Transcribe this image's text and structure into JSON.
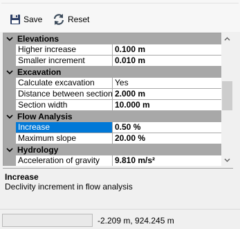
{
  "toolbar": {
    "save_label": "Save",
    "reset_label": "Reset"
  },
  "grid": {
    "categories": [
      {
        "label": "Elevations",
        "properties": [
          {
            "name": "Higher increase",
            "value": "0.100 m"
          },
          {
            "name": "Smaller increment",
            "value": "0.010 m"
          }
        ]
      },
      {
        "label": "Excavation",
        "properties": [
          {
            "name": "Calculate excavation",
            "value": "Yes"
          },
          {
            "name": "Distance between sections",
            "value": "2.000 m"
          },
          {
            "name": "Section width",
            "value": "10.000 m"
          }
        ]
      },
      {
        "label": "Flow Analysis",
        "properties": [
          {
            "name": "Increase",
            "value": "0.50 %"
          },
          {
            "name": "Maximum slope",
            "value": "20.00 %"
          }
        ]
      },
      {
        "label": "Hydrology",
        "properties": [
          {
            "name": "Acceleration of gravity",
            "value": "9.810 m/s²"
          }
        ]
      }
    ]
  },
  "help": {
    "title": "Increase",
    "description": "Declivity increment in flow analysis"
  },
  "status": {
    "coordinates": "-2.209 m, 924.245 m"
  },
  "colors": {
    "selection": "#0078d7",
    "category_bg": "#a8a8a8"
  }
}
